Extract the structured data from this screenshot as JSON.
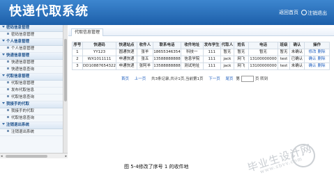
{
  "header": {
    "app_title": "快递代取系统",
    "home_label": "返回首页",
    "logout_label": "注销退出"
  },
  "sidebar": {
    "groups": [
      {
        "title": "密码信息管理",
        "items": [
          "密码信息管理"
        ]
      },
      {
        "title": "个人信息管理",
        "items": [
          "个人信息管理"
        ]
      },
      {
        "title": "快递信息管理",
        "items": [
          "快递信息管理",
          "快递信息查询"
        ]
      },
      {
        "title": "代取信息管理",
        "items": [
          "代取信息管理",
          "发布代取信息",
          "代取信息查询"
        ]
      },
      {
        "title": "我接手的代取",
        "items": [
          "我接手的代取",
          "代取信息查询"
        ]
      },
      {
        "title": "注销退出系统",
        "items": [
          "注销退出系统"
        ]
      }
    ]
  },
  "main": {
    "tab_label": "代取信息管理",
    "table": {
      "headers": [
        "序号",
        "快递码",
        "快递站点",
        "收件人",
        "联系电话",
        "收件地址",
        "发布学生",
        "代取人",
        "姓名",
        "电话",
        "班级",
        "确认",
        "操作"
      ],
      "rows": [
        [
          "1",
          "YY123",
          "圆通快递",
          "张羊",
          "18655346354",
          "科技一",
          "111",
          "暂无",
          "暂无",
          "暂无",
          "暂无",
          "未确认"
        ],
        [
          "2",
          "WX1011111",
          "申通快递",
          "张五",
          "13588888888",
          "信息学院",
          "111",
          "jack",
          "网飞",
          "13100000000",
          "test",
          "已确认"
        ],
        [
          "3",
          "DD10887654322",
          "申通快递",
          "张阿羊",
          "13588888888",
          "测试地址",
          "111",
          "jack",
          "网飞",
          "13100000000",
          "test",
          "未确认"
        ]
      ],
      "actions": {
        "row1": [
          "修改",
          "删除"
        ],
        "row2": [
          "确认",
          "删除"
        ],
        "row3": [
          "确认",
          "删除"
        ]
      }
    },
    "pager": {
      "first": "首页",
      "prev": "上一页",
      "info": "共3条记录,共计1页,当前第1页",
      "next": "下一页",
      "last": "尾页",
      "goto_prefix": "第",
      "goto_suffix": "页 转到"
    }
  },
  "caption": "图 5-4修改了序号 1 的收件地",
  "watermark": {
    "text": "毕业生设计网",
    "url": "www.sbvv.com"
  },
  "colors": {
    "header": "#2a6fba",
    "sidebar_bg": "#f3f7fb",
    "link": "#1f5fbf"
  }
}
